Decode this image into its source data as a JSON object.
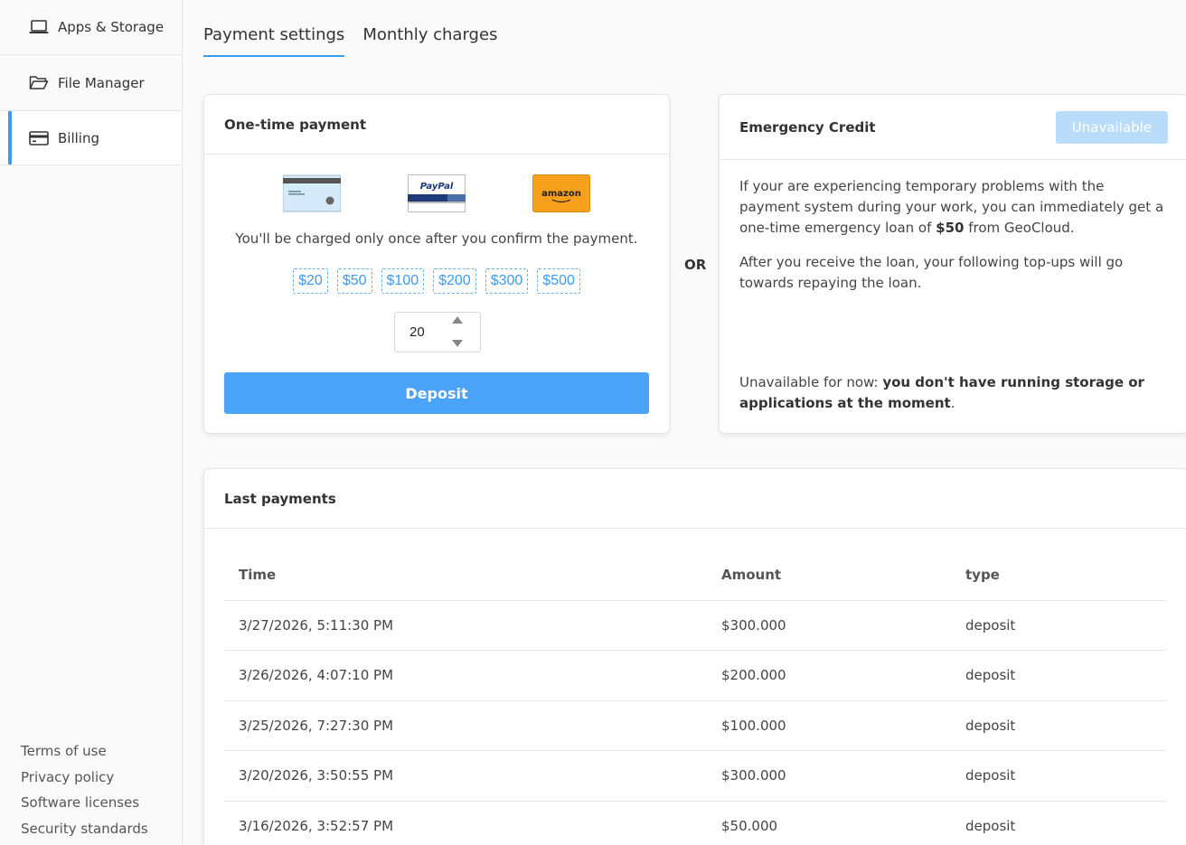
{
  "sidebar": {
    "items": [
      {
        "label": "Apps & Storage",
        "icon": "laptop-icon"
      },
      {
        "label": "File Manager",
        "icon": "folder-icon"
      },
      {
        "label": "Billing",
        "icon": "credit-card-icon",
        "active": true
      }
    ],
    "footer": [
      "Terms of use",
      "Privacy policy",
      "Software licenses",
      "Security standards"
    ]
  },
  "tabs": [
    {
      "label": "Payment settings",
      "active": true
    },
    {
      "label": "Monthly charges"
    }
  ],
  "one_time": {
    "title": "One-time payment",
    "methods": [
      "credit-card-icon",
      "paypal-logo",
      "amazon-logo"
    ],
    "paypal_text": "PayPal",
    "amazon_text": "amazon",
    "note": "You'll be charged only once after you confirm the payment.",
    "amounts": [
      "$20",
      "$50",
      "$100",
      "$200",
      "$300",
      "$500"
    ],
    "stepper_value": "20",
    "deposit_label": "Deposit"
  },
  "or_label": "OR",
  "emergency": {
    "title": "Emergency Credit",
    "button_label": "Unavailable",
    "p1_before": "If your are experiencing temporary problems with the payment system during your work, you can immediately get a one-time emergency loan of ",
    "p1_amount": "$50",
    "p1_after": " from GeoCloud.",
    "p2": "After you receive the loan, your following top-ups will go towards repaying the loan.",
    "note_prefix": "Unavailable for now: ",
    "note_bold": "you don't have running storage or applications at the moment",
    "note_suffix": "."
  },
  "payments": {
    "title": "Last payments",
    "headers": [
      "Time",
      "Amount",
      "type"
    ],
    "rows": [
      [
        "3/27/2026, 5:11:30 PM",
        "$300.000",
        "deposit"
      ],
      [
        "3/26/2026, 4:07:10 PM",
        "$200.000",
        "deposit"
      ],
      [
        "3/25/2026, 7:27:30 PM",
        "$100.000",
        "deposit"
      ],
      [
        "3/20/2026, 3:50:55 PM",
        "$300.000",
        "deposit"
      ],
      [
        "3/16/2026, 3:52:57 PM",
        "$50.000",
        "deposit"
      ]
    ]
  },
  "colors": {
    "accent": "#3a9bf0",
    "deposit_button": "#4ba3f7",
    "unavailable_button": "#b9dcfb",
    "amazon": "#f7a01c"
  }
}
